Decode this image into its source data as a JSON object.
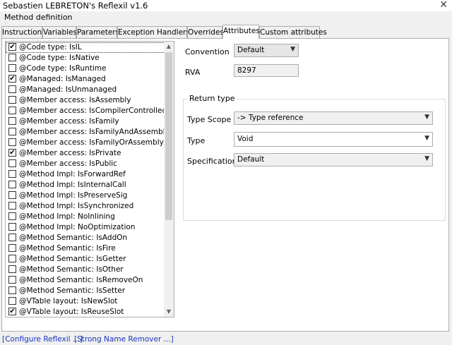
{
  "window": {
    "title": "Sebastien LEBRETON's Reflexil v1.6",
    "close_glyph": "✕"
  },
  "menu": {
    "label": "Method definition"
  },
  "tabs": [
    "Instructions",
    "Variables",
    "Parameters",
    "Exception Handlers",
    "Overrides",
    "Attributes",
    "Custom attributes"
  ],
  "active_tab": "Attributes",
  "attributes": [
    {
      "label": "@Code type: IsIL",
      "checked": true
    },
    {
      "label": "@Code type: IsNative",
      "checked": false
    },
    {
      "label": "@Code type: IsRuntime",
      "checked": false
    },
    {
      "label": "@Managed: IsManaged",
      "checked": true
    },
    {
      "label": "@Managed: IsUnmanaged",
      "checked": false
    },
    {
      "label": "@Member access: IsAssembly",
      "checked": false
    },
    {
      "label": "@Member access: IsCompilerControlled",
      "checked": false
    },
    {
      "label": "@Member access: IsFamily",
      "checked": false
    },
    {
      "label": "@Member access: IsFamilyAndAssembly",
      "checked": false
    },
    {
      "label": "@Member access: IsFamilyOrAssembly",
      "checked": false
    },
    {
      "label": "@Member access: IsPrivate",
      "checked": true
    },
    {
      "label": "@Member access: IsPublic",
      "checked": false
    },
    {
      "label": "@Method Impl: IsForwardRef",
      "checked": false
    },
    {
      "label": "@Method Impl: IsInternalCall",
      "checked": false
    },
    {
      "label": "@Method Impl: IsPreserveSig",
      "checked": false
    },
    {
      "label": "@Method Impl: IsSynchronized",
      "checked": false
    },
    {
      "label": "@Method Impl: NoInlining",
      "checked": false
    },
    {
      "label": "@Method Impl: NoOptimization",
      "checked": false
    },
    {
      "label": "@Method Semantic: IsAddOn",
      "checked": false
    },
    {
      "label": "@Method Semantic: IsFire",
      "checked": false
    },
    {
      "label": "@Method Semantic: IsGetter",
      "checked": false
    },
    {
      "label": "@Method Semantic: IsOther",
      "checked": false
    },
    {
      "label": "@Method Semantic: IsRemoveOn",
      "checked": false
    },
    {
      "label": "@Method Semantic: IsSetter",
      "checked": false
    },
    {
      "label": "@VTable layout: IsNewSlot",
      "checked": false
    },
    {
      "label": "@VTable layout: IsReuseSlot",
      "checked": true
    }
  ],
  "checkmark": "✔",
  "scroll": {
    "up": "▲",
    "down": "▼"
  },
  "details": {
    "convention_label": "Convention",
    "convention_value": "Default",
    "rva_label": "RVA",
    "rva_value": "8297",
    "return_type_legend": "Return type",
    "type_scope_label": "Type Scope",
    "type_scope_value": "-> Type reference",
    "type_label": "Type",
    "type_value": "Void",
    "specification_label": "Specification",
    "specification_value": "Default",
    "dropdown_glyph": "▼"
  },
  "footer": {
    "configure_link": "[Configure Reflexil ...]",
    "snr_link": "[Strong Name Remover ...]"
  }
}
